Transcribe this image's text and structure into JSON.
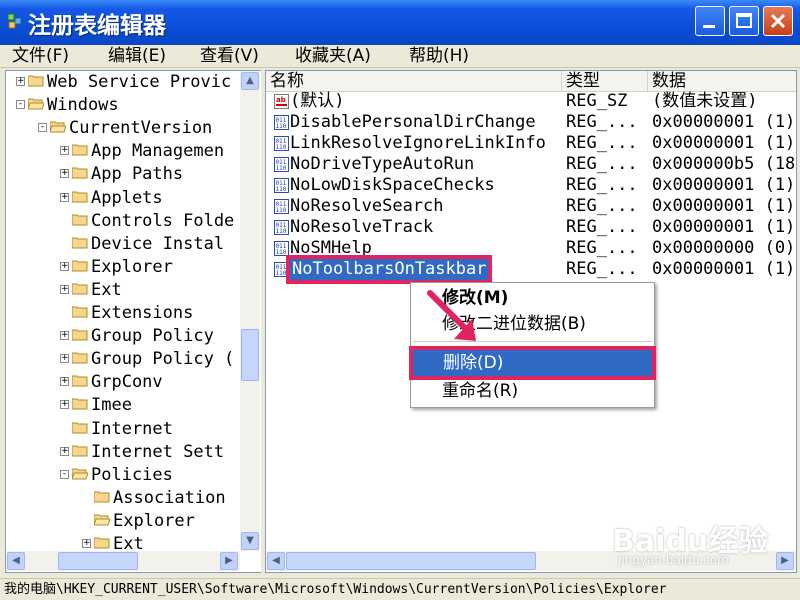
{
  "window": {
    "title": "注册表编辑器",
    "minimize_icon": "minimize-icon",
    "maximize_icon": "maximize-icon",
    "close_icon": "close-icon"
  },
  "menu": [
    "文件(F)",
    "编辑(E)",
    "查看(V)",
    "收藏夹(A)",
    "帮助(H)"
  ],
  "tree": [
    {
      "label": "Web Service Provic",
      "expander": "+"
    },
    {
      "label": "Windows",
      "expander": "-"
    },
    {
      "label": "CurrentVersion",
      "expander": "-"
    },
    {
      "label": "App Managemen",
      "expander": "+"
    },
    {
      "label": "App Paths",
      "expander": "+"
    },
    {
      "label": "Applets",
      "expander": "+"
    },
    {
      "label": "Controls Folde",
      "expander": ""
    },
    {
      "label": "Device Instal",
      "expander": ""
    },
    {
      "label": "Explorer",
      "expander": "+"
    },
    {
      "label": "Ext",
      "expander": "+"
    },
    {
      "label": "Extensions",
      "expander": ""
    },
    {
      "label": "Group Policy",
      "expander": "+"
    },
    {
      "label": "Group Policy (",
      "expander": "+"
    },
    {
      "label": "GrpConv",
      "expander": "+"
    },
    {
      "label": "Imee",
      "expander": "+"
    },
    {
      "label": "Internet",
      "expander": ""
    },
    {
      "label": "Internet Sett",
      "expander": "+"
    },
    {
      "label": "Policies",
      "expander": "-"
    },
    {
      "label": "Association",
      "expander": ""
    },
    {
      "label": "Explorer",
      "expander": ""
    },
    {
      "label": "Ext",
      "expander": "+"
    }
  ],
  "list": {
    "headers": {
      "name": "名称",
      "type": "类型",
      "data": "数据"
    },
    "rows": [
      {
        "name": "(默认)",
        "type": "REG_SZ",
        "data": "(数值未设置)",
        "icon": "string-value-icon"
      },
      {
        "name": "DisablePersonalDirChange",
        "type": "REG_...",
        "data": "0x00000001 (1)",
        "icon": "dword-value-icon"
      },
      {
        "name": "LinkResolveIgnoreLinkInfo",
        "type": "REG_...",
        "data": "0x00000001 (1)",
        "icon": "dword-value-icon"
      },
      {
        "name": "NoDriveTypeAutoRun",
        "type": "REG_...",
        "data": "0x000000b5 (18",
        "icon": "dword-value-icon"
      },
      {
        "name": "NoLowDiskSpaceChecks",
        "type": "REG_...",
        "data": "0x00000001 (1)",
        "icon": "dword-value-icon"
      },
      {
        "name": "NoResolveSearch",
        "type": "REG_...",
        "data": "0x00000001 (1)",
        "icon": "dword-value-icon"
      },
      {
        "name": "NoResolveTrack",
        "type": "REG_...",
        "data": "0x00000001 (1)",
        "icon": "dword-value-icon"
      },
      {
        "name": "NoSMHelp",
        "type": "REG_...",
        "data": "0x00000000 (0)",
        "icon": "dword-value-icon"
      },
      {
        "name": "NoToolbarsOnTaskbar",
        "type": "REG_...",
        "data": "0x00000001 (1)",
        "icon": "dword-value-icon",
        "selected": true
      }
    ]
  },
  "context_menu": {
    "modify": "修改(M)",
    "modify_binary": "修改二进位数据(B)",
    "delete": "删除(D)",
    "rename": "重命名(R)"
  },
  "status": "我的电脑\\HKEY_CURRENT_USER\\Software\\Microsoft\\Windows\\CurrentVersion\\Policies\\Explorer",
  "watermark": {
    "logo": "Baidu经验",
    "url": "jingyan.baidu.com"
  },
  "colors": {
    "selection": "#316ac5",
    "highlight_outline": "#e0245e",
    "titlebar": "#0a4fd8"
  }
}
